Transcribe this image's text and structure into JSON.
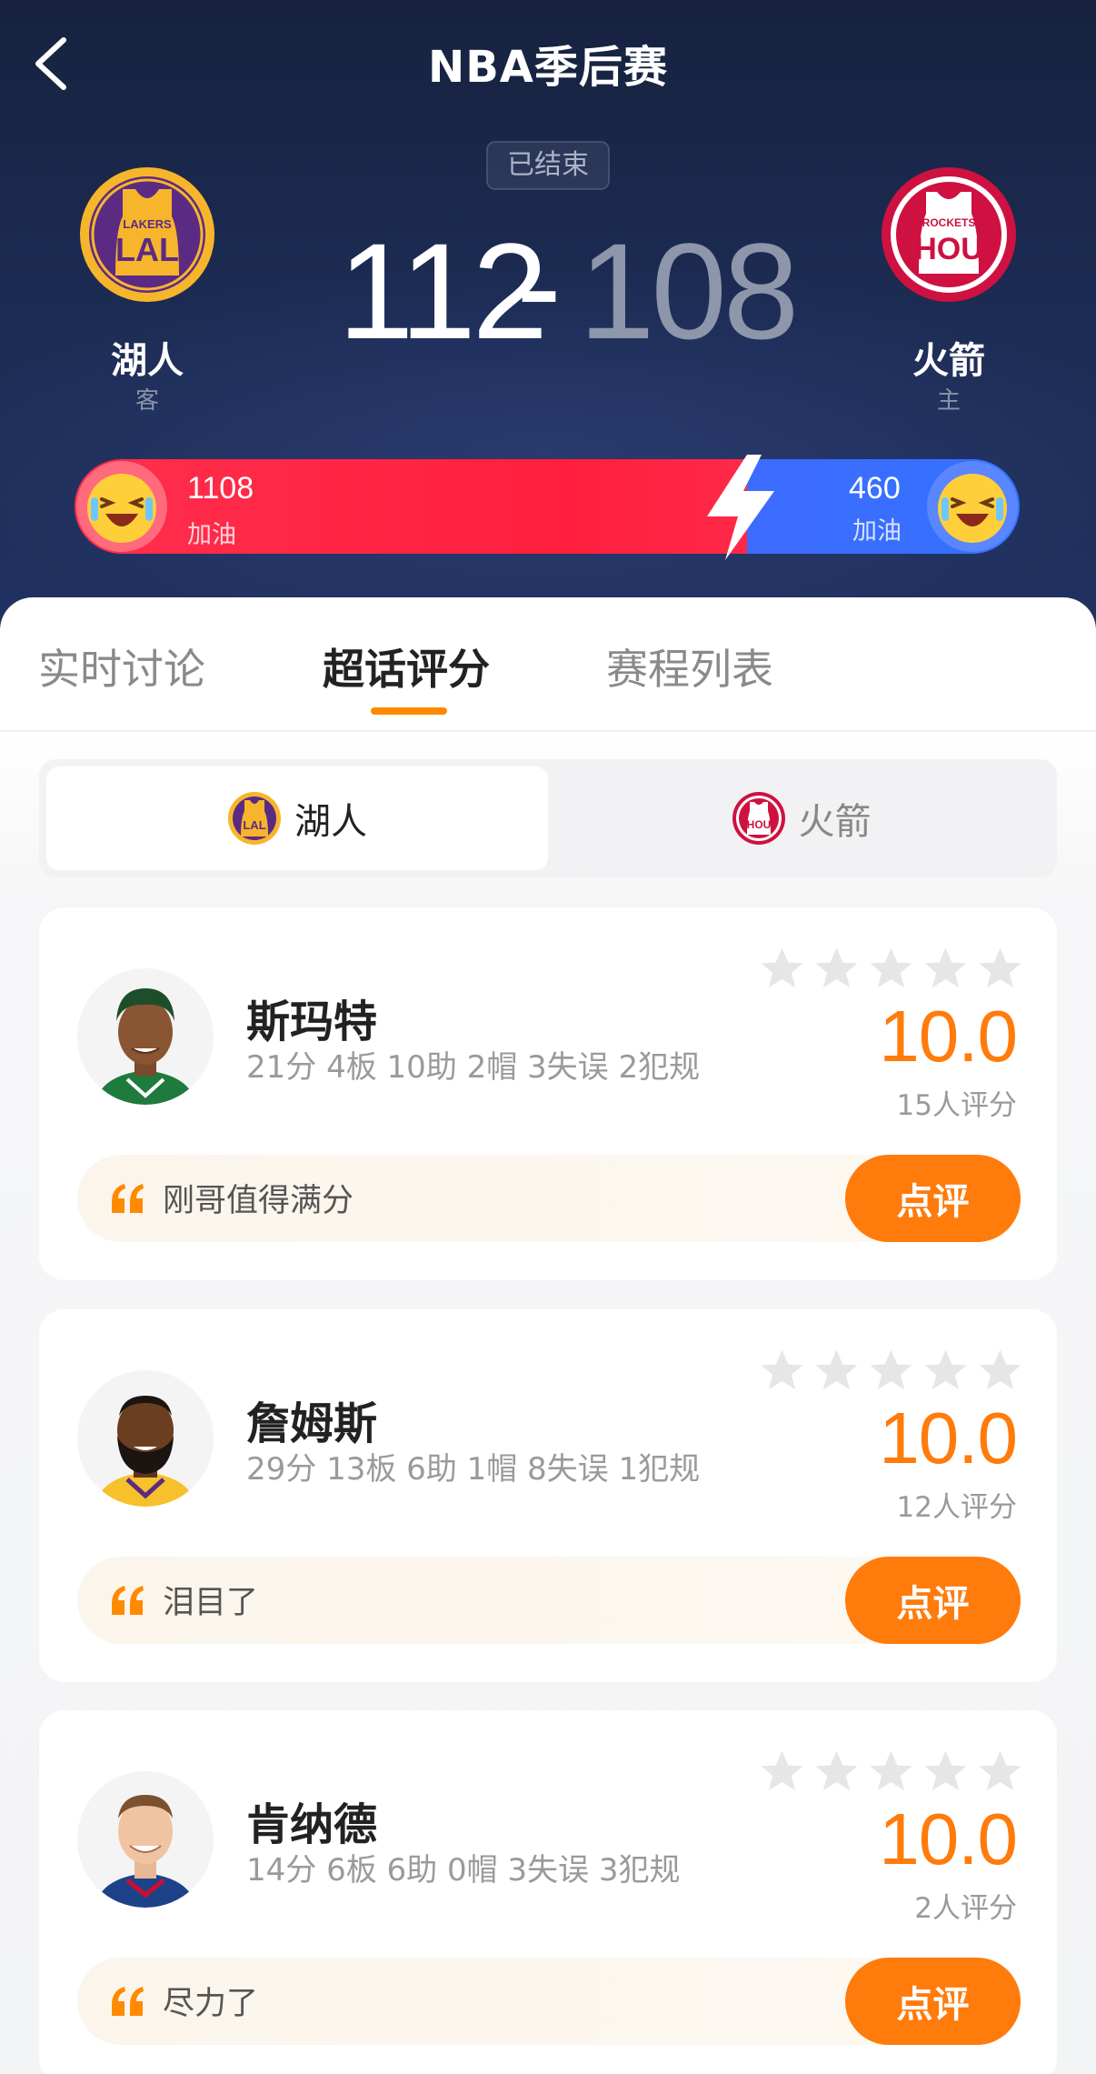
{
  "header": {
    "title": "NBA季后赛",
    "status": "已结束",
    "away_team": {
      "name": "湖人",
      "role": "客",
      "score": "112",
      "logo_text": "LAL",
      "logo_sub": "LAKERS"
    },
    "home_team": {
      "name": "火箭",
      "role": "主",
      "score": "108",
      "logo_text": "HOU",
      "logo_sub": "ROCKETS"
    },
    "score_separator": "-"
  },
  "cheer": {
    "away_count": "1108",
    "away_label": "加油",
    "home_count": "460",
    "home_label": "加油"
  },
  "tabs": [
    "实时讨论",
    "超话评分",
    "赛程列表"
  ],
  "active_tab": "超话评分",
  "team_switch": {
    "options": [
      "湖人",
      "火箭"
    ],
    "selected": "湖人"
  },
  "players": [
    {
      "name": "斯玛特",
      "stats": "21分 4板 10助 2帽 3失误 2犯规",
      "rating": "10.0",
      "raters": "15人评分",
      "comment": "刚哥值得满分",
      "button": "点评"
    },
    {
      "name": "詹姆斯",
      "stats": "29分 13板 6助 1帽 8失误 1犯规",
      "rating": "10.0",
      "raters": "12人评分",
      "comment": "泪目了",
      "button": "点评"
    },
    {
      "name": "肯纳德",
      "stats": "14分 6板 6助 0帽 3失误 3犯规",
      "rating": "10.0",
      "raters": "2人评分",
      "comment": "尽力了",
      "button": "点评"
    }
  ],
  "colors": {
    "accent": "#ff7b0c",
    "cheer_away": "#ff2e4d",
    "cheer_home": "#3d6bff",
    "header_bg": "#1c2b52"
  },
  "icons": [
    "back-icon",
    "lightning-icon",
    "cheer-emoji-icon",
    "star-icon",
    "quote-icon"
  ]
}
